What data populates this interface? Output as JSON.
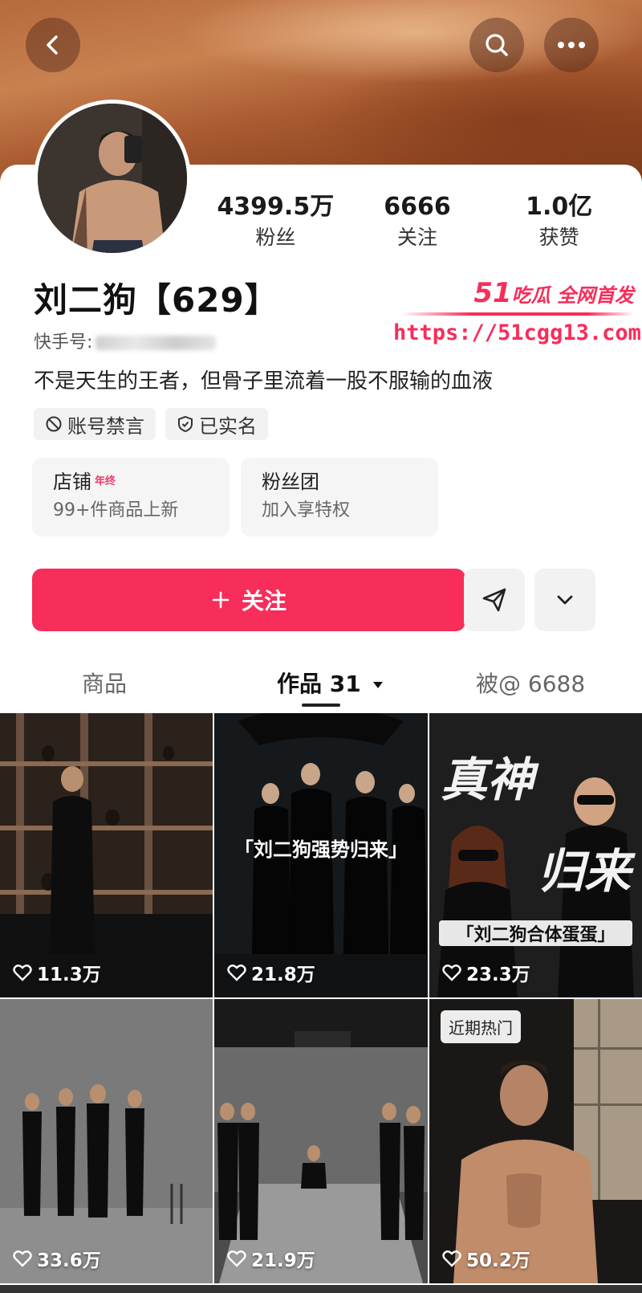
{
  "header": {
    "back": "back",
    "search": "search",
    "more": "more"
  },
  "profile": {
    "name": "刘二狗【629】",
    "uid_label": "快手号:",
    "bio": "不是天生的王者，但骨子里流着一股不服输的血液",
    "stats": [
      {
        "value": "4399.5万",
        "label": "粉丝"
      },
      {
        "value": "6666",
        "label": "关注"
      },
      {
        "value": "1.0亿",
        "label": "获赞"
      }
    ],
    "tags": [
      {
        "icon": "ban-icon",
        "label": "账号禁言"
      },
      {
        "icon": "shield-check-icon",
        "label": "已实名"
      }
    ]
  },
  "shop": {
    "title": "店铺",
    "badge": "年终",
    "subtitle": "99+件商品上新"
  },
  "fans": {
    "title": "粉丝团",
    "subtitle": "加入享特权"
  },
  "actions": {
    "follow_label": "关注"
  },
  "tabs": [
    {
      "label": "商品"
    },
    {
      "label": "作品 31"
    },
    {
      "label": "被@ 6688"
    }
  ],
  "videos": [
    {
      "likes": "11.3万"
    },
    {
      "likes": "21.8万",
      "caption": "「刘二狗强势归来」"
    },
    {
      "likes": "23.3万",
      "title_top": "真神",
      "title_bottom": "归来",
      "caption": "「刘二狗合体蛋蛋」"
    },
    {
      "likes": "33.6万"
    },
    {
      "likes": "21.9万"
    },
    {
      "likes": "50.2万",
      "badge": "近期热门"
    }
  ],
  "watermark": {
    "brand": "51",
    "tagline": "吃瓜 全网首发",
    "url": "https://51cgg13.com"
  },
  "colors": {
    "accent": "#f72d5a",
    "banner": "#b66a3d"
  }
}
